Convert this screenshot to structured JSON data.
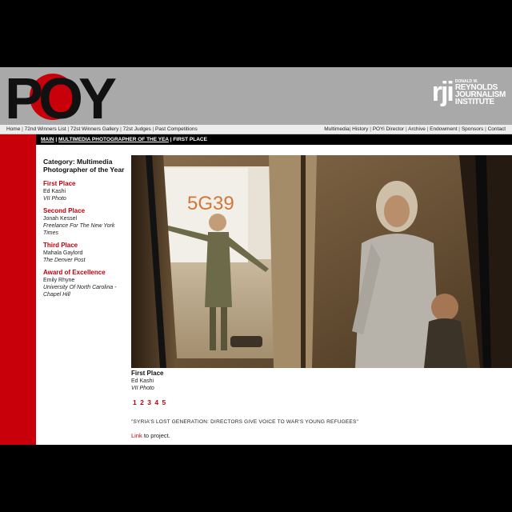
{
  "header": {
    "logo_text": "POY",
    "rji_mark": "rji",
    "rji_line1": "DONALD W.",
    "rji_line2": "REYNOLDS",
    "rji_line3": "JOURNALISM",
    "rji_line4": "INSTITUTE",
    "colors": {
      "header_bg": "#a9a9a9",
      "logo_red": "#c8000a",
      "logo_black": "#111111"
    }
  },
  "nav": {
    "left": [
      "Home",
      "72nd Winners List",
      "72st Winners Gallery",
      "72st Judges",
      "Past Competitions"
    ],
    "right": [
      "Multimedia",
      "History",
      "POYi Director",
      "Archive",
      "Endowment",
      "Sponsors",
      "Contact"
    ]
  },
  "breadcrumb": {
    "items": [
      "MAIN",
      "MULTIMEDIA PHOTOGRAPHER OF THE YEA",
      "FIRST PLACE"
    ]
  },
  "sidebar": {
    "category": "Category: Multimedia Photographer of the Year",
    "awards": [
      {
        "title": "First Place",
        "name": "Ed Kashi",
        "org": "VII Photo"
      },
      {
        "title": "Second Place",
        "name": "Jonah Kessel",
        "org": "Freelance For The New York Times"
      },
      {
        "title": "Third Place",
        "name": "Mahala Gaylord",
        "org": "The Denver Post"
      },
      {
        "title": "Award of Excellence",
        "name": "Emily Rhyne",
        "org": "University Of North Carolina - Chapel Hill"
      }
    ]
  },
  "photo": {
    "tent_label": "5G39",
    "icon": "photo-of-refugee-tent"
  },
  "caption": {
    "title": "First Place",
    "name": "Ed Kashi",
    "org": "VII Photo"
  },
  "pager": [
    "1",
    "2",
    "3",
    "4",
    "5"
  ],
  "project": {
    "title": "\"SYRIA'S LOST GENERATION: DIRECTORS GIVE VOICE TO WAR'S YOUNG REFUGEES\"",
    "link_label": "Link",
    "link_suffix": " to project."
  },
  "colors": {
    "accent_red": "#c8000a",
    "link_red": "#c0000c"
  }
}
